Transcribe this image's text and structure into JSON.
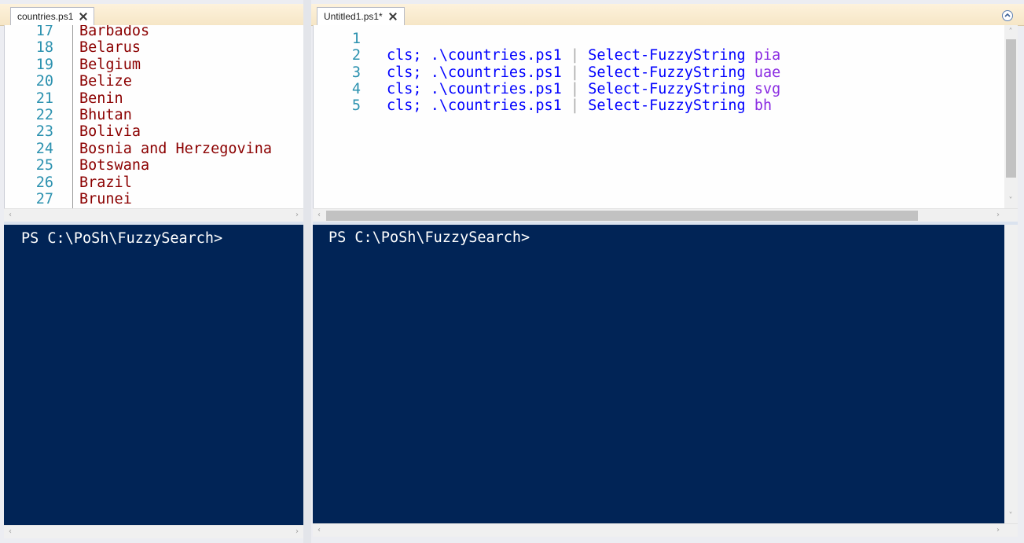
{
  "left_pane": {
    "tab_label": "countries.ps1",
    "lines": [
      {
        "num": "17",
        "text": "Barbados"
      },
      {
        "num": "18",
        "text": "Belarus"
      },
      {
        "num": "19",
        "text": "Belgium"
      },
      {
        "num": "20",
        "text": "Belize"
      },
      {
        "num": "21",
        "text": "Benin"
      },
      {
        "num": "22",
        "text": "Bhutan"
      },
      {
        "num": "23",
        "text": "Bolivia"
      },
      {
        "num": "24",
        "text": "Bosnia and Herzegovina"
      },
      {
        "num": "25",
        "text": "Botswana"
      },
      {
        "num": "26",
        "text": "Brazil"
      },
      {
        "num": "27",
        "text": "Brunei"
      }
    ],
    "console_prompt": "PS C:\\PoSh\\FuzzySearch>"
  },
  "right_pane": {
    "tab_label": "Untitled1.ps1*",
    "lines": [
      {
        "num": "1",
        "cmd": "",
        "pipe": "",
        "fn": "",
        "arg": ""
      },
      {
        "num": "2",
        "cmd": "cls; .\\countries.ps1",
        "pipe": "|",
        "fn": "Select-FuzzyString",
        "arg": "pia"
      },
      {
        "num": "3",
        "cmd": "cls; .\\countries.ps1",
        "pipe": "|",
        "fn": "Select-FuzzyString",
        "arg": "uae"
      },
      {
        "num": "4",
        "cmd": "cls; .\\countries.ps1",
        "pipe": "|",
        "fn": "Select-FuzzyString",
        "arg": "svg"
      },
      {
        "num": "5",
        "cmd": "cls; .\\countries.ps1",
        "pipe": "|",
        "fn": "Select-FuzzyString",
        "arg": "bh"
      }
    ],
    "console_prompt": "PS C:\\PoSh\\FuzzySearch>"
  },
  "icons": {
    "tab_close": "close-icon",
    "collapse_script_pane": "chevron-up-circle-icon",
    "scroll_left": "chevron-left-icon",
    "scroll_right": "chevron-right-icon",
    "scroll_up": "chevron-up-icon",
    "scroll_down": "chevron-down-icon"
  },
  "colors": {
    "console_background": "#012456",
    "line_number": "#2b91af",
    "command": "#0000ff",
    "argument": "#8a2be2",
    "string": "#8b0000",
    "pipe": "#a9a9a9",
    "tabstrip": "#fdf2dc"
  }
}
